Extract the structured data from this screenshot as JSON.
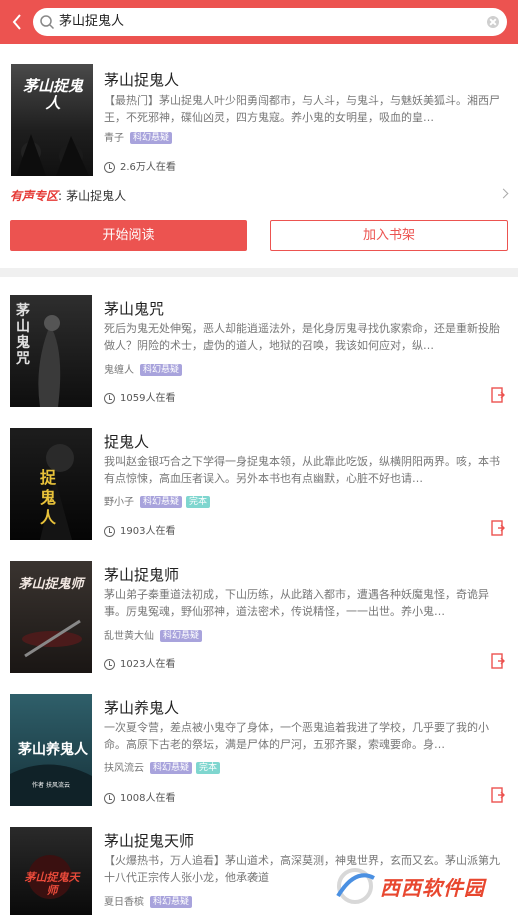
{
  "search": {
    "query": "茅山捉鬼人"
  },
  "featured": {
    "title": "茅山捉鬼人",
    "desc": "【最热门】茅山捉鬼人叶少阳勇闯都市，与人斗，与鬼斗，与魅妖美狐斗。湘西尸王，不死邪神，碟仙凶灵，四方鬼寇。养小鬼的女明星，吸血的皇…",
    "author": "青子",
    "tags": [
      "科幻悬疑"
    ],
    "reads": "2.6万人在看",
    "cover_text": "茅山捉鬼人",
    "audio_label": "有声专区",
    "audio_sep": ":",
    "audio_title": "茅山捉鬼人",
    "read_button": "开始阅读",
    "shelf_button": "加入书架"
  },
  "books": [
    {
      "title": "茅山鬼咒",
      "desc": "死后为鬼无处伸冤，恶人却能逍遥法外，是化身厉鬼寻找仇家索命，还是重新投胎做人？阴险的术士，虚伪的道人，地狱的召唤，我该如何应对，纵…",
      "author": "鬼缠人",
      "tags": [
        {
          "t": "科幻悬疑",
          "k": "genre"
        }
      ],
      "reads": "1059人在看",
      "cover_text": "茅山鬼咒"
    },
    {
      "title": "捉鬼人",
      "desc": "我叫赵金银巧合之下学得一身捉鬼本领，从此靠此吃饭，纵横阴阳两界。咳，本书有点惊悚，高血压者误入。另外本书也有点幽默，心脏不好也请…",
      "author": "野小子",
      "tags": [
        {
          "t": "科幻悬疑",
          "k": "genre"
        },
        {
          "t": "完本",
          "k": "done"
        }
      ],
      "reads": "1903人在看",
      "cover_text": "捉鬼人"
    },
    {
      "title": "茅山捉鬼师",
      "desc": "茅山弟子秦重道法初成，下山历练，从此踏入都市，遭遇各种妖魔鬼怪，奇诡异事。厉鬼冤魂，野仙邪神，道法密术，传说精怪，一一出世。养小鬼…",
      "author": "乱世黄大仙",
      "tags": [
        {
          "t": "科幻悬疑",
          "k": "genre"
        }
      ],
      "reads": "1023人在看",
      "cover_text": "茅山捉鬼师"
    },
    {
      "title": "茅山养鬼人",
      "desc": "一次夏令营，差点被小鬼夺了身体，一个恶鬼追着我进了学校，几乎要了我的小命。高原下古老的祭坛，满是尸体的尸河，五邪齐聚，索魂要命。身…",
      "author": "扶风流云",
      "tags": [
        {
          "t": "科幻悬疑",
          "k": "genre"
        },
        {
          "t": "完本",
          "k": "done"
        }
      ],
      "reads": "1008人在看",
      "cover_text": "茅山养鬼人",
      "cover_sub": "作者  扶风流云"
    },
    {
      "title": "茅山捉鬼天师",
      "desc": "【火爆热书，万人追看】茅山道术，高深莫测，神鬼世界，玄而又玄。茅山派第九十八代正宗传人张小龙，他承袭道",
      "author": "夏日香槟",
      "tags": [
        {
          "t": "科幻悬疑",
          "k": "genre"
        }
      ],
      "reads": "",
      "cover_text": "茅山捉鬼天师"
    }
  ],
  "watermark": {
    "text": "西西软件园"
  },
  "colors": {
    "accent": "#ec5350",
    "genre_tag": "#a8a3dc",
    "done_tag": "#7fd6cf"
  },
  "icons": {
    "back": "chevron-left-icon",
    "search": "search-icon",
    "clear": "clear-icon",
    "clock": "clock-icon",
    "add": "add-to-shelf-icon",
    "arrow": "chevron-right-icon"
  }
}
